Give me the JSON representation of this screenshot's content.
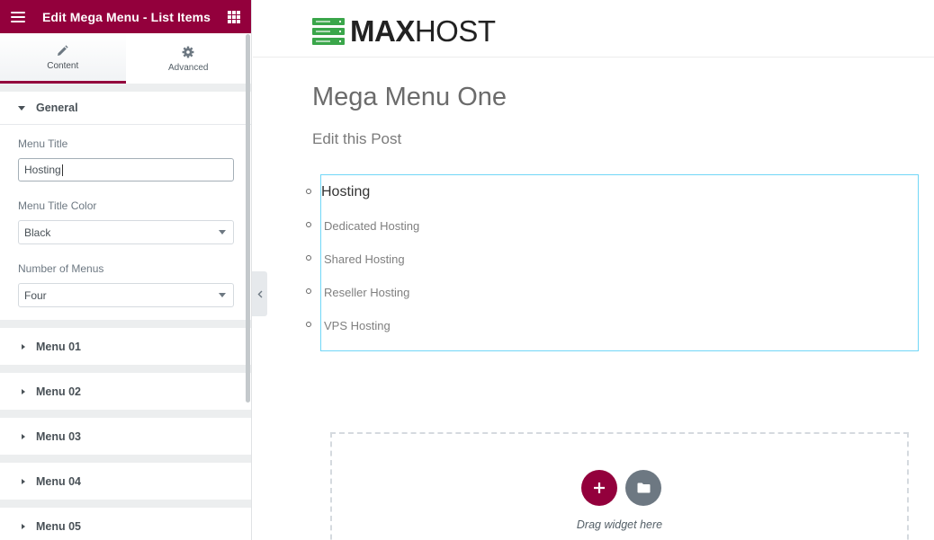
{
  "panel": {
    "header_title": "Edit Mega Menu - List Items",
    "tabs": [
      {
        "label": "Content",
        "icon": "pencil-icon"
      },
      {
        "label": "Advanced",
        "icon": "gear-icon"
      }
    ],
    "general": {
      "heading": "General",
      "menu_title_label": "Menu Title",
      "menu_title_value": "Hosting",
      "color_label": "Menu Title Color",
      "color_value": "Black",
      "count_label": "Number of Menus",
      "count_value": "Four"
    },
    "sections": [
      "Menu 01",
      "Menu 02",
      "Menu 03",
      "Menu 04",
      "Menu 05"
    ]
  },
  "site": {
    "logo_bold": "MAX",
    "logo_light": "HOST",
    "page_title": "Mega Menu One",
    "edit_link": "Edit this Post"
  },
  "widget": {
    "heading": "Hosting",
    "items": [
      "Dedicated Hosting",
      "Shared Hosting",
      "Reseller Hosting",
      "VPS Hosting"
    ]
  },
  "dropzone": {
    "text": "Drag widget here"
  },
  "colors": {
    "accent": "#93003c",
    "logo_green": "#3aa64a",
    "widget_border": "#71d7f7"
  }
}
